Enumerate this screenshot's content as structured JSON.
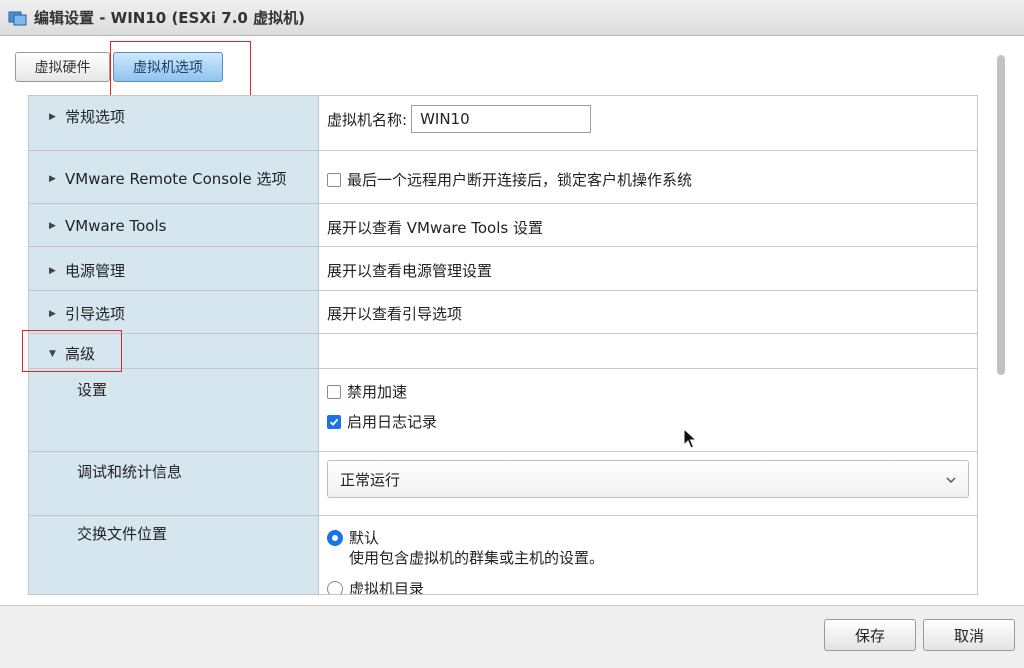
{
  "window": {
    "title": "编辑设置 - WIN10 (ESXi 7.0 虚拟机)",
    "icon": "vm-icon"
  },
  "tabs": [
    {
      "label": "虚拟硬件",
      "active": false
    },
    {
      "label": "虚拟机选项",
      "active": true
    }
  ],
  "sections": {
    "general": {
      "label": "常规选项",
      "name_label": "虚拟机名称:",
      "name_value": "WIN10"
    },
    "vmrc": {
      "label": "VMware Remote Console 选项",
      "checkbox_label": "最后一个远程用户断开连接后，锁定客户机操作系统",
      "checked": false
    },
    "tools": {
      "label": "VMware Tools",
      "value": "展开以查看 VMware Tools 设置"
    },
    "power": {
      "label": "电源管理",
      "value": "展开以查看电源管理设置"
    },
    "boot": {
      "label": "引导选项",
      "value": "展开以查看引导选项"
    },
    "advanced": {
      "label": "高级",
      "settings_label": "设置",
      "disable_accel": {
        "label": "禁用加速",
        "checked": false
      },
      "enable_logging": {
        "label": "启用日志记录",
        "checked": true
      },
      "debug_label": "调试和统计信息",
      "debug_value": "正常运行",
      "swap_label": "交换文件位置",
      "swap_default": {
        "label": "默认",
        "desc": "使用包含虚拟机的群集或主机的设置。",
        "selected": true
      },
      "swap_vmdir": {
        "label": "虚拟机目录",
        "selected": false
      }
    }
  },
  "footer": {
    "save_label": "保存",
    "cancel_label": "取消"
  },
  "colors": {
    "accent": "#1a73e8",
    "left_column": "#d6e6ee",
    "highlight_box": "#e0242b"
  }
}
